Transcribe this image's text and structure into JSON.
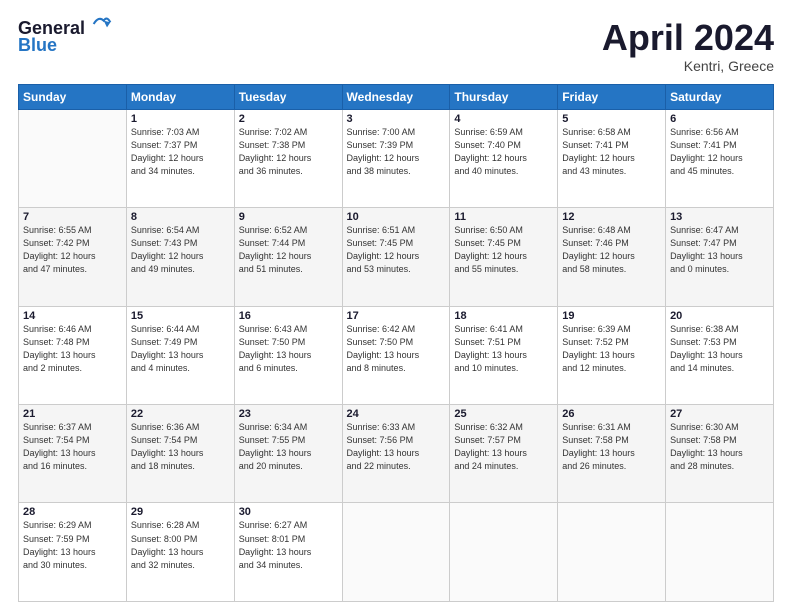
{
  "header": {
    "logo_line1": "General",
    "logo_line2": "Blue",
    "month_title": "April 2024",
    "location": "Kentri, Greece"
  },
  "weekdays": [
    "Sunday",
    "Monday",
    "Tuesday",
    "Wednesday",
    "Thursday",
    "Friday",
    "Saturday"
  ],
  "weeks": [
    [
      {
        "day": "",
        "sunrise": "",
        "sunset": "",
        "daylight": ""
      },
      {
        "day": "1",
        "sunrise": "Sunrise: 7:03 AM",
        "sunset": "Sunset: 7:37 PM",
        "daylight": "Daylight: 12 hours and 34 minutes."
      },
      {
        "day": "2",
        "sunrise": "Sunrise: 7:02 AM",
        "sunset": "Sunset: 7:38 PM",
        "daylight": "Daylight: 12 hours and 36 minutes."
      },
      {
        "day": "3",
        "sunrise": "Sunrise: 7:00 AM",
        "sunset": "Sunset: 7:39 PM",
        "daylight": "Daylight: 12 hours and 38 minutes."
      },
      {
        "day": "4",
        "sunrise": "Sunrise: 6:59 AM",
        "sunset": "Sunset: 7:40 PM",
        "daylight": "Daylight: 12 hours and 40 minutes."
      },
      {
        "day": "5",
        "sunrise": "Sunrise: 6:58 AM",
        "sunset": "Sunset: 7:41 PM",
        "daylight": "Daylight: 12 hours and 43 minutes."
      },
      {
        "day": "6",
        "sunrise": "Sunrise: 6:56 AM",
        "sunset": "Sunset: 7:41 PM",
        "daylight": "Daylight: 12 hours and 45 minutes."
      }
    ],
    [
      {
        "day": "7",
        "sunrise": "Sunrise: 6:55 AM",
        "sunset": "Sunset: 7:42 PM",
        "daylight": "Daylight: 12 hours and 47 minutes."
      },
      {
        "day": "8",
        "sunrise": "Sunrise: 6:54 AM",
        "sunset": "Sunset: 7:43 PM",
        "daylight": "Daylight: 12 hours and 49 minutes."
      },
      {
        "day": "9",
        "sunrise": "Sunrise: 6:52 AM",
        "sunset": "Sunset: 7:44 PM",
        "daylight": "Daylight: 12 hours and 51 minutes."
      },
      {
        "day": "10",
        "sunrise": "Sunrise: 6:51 AM",
        "sunset": "Sunset: 7:45 PM",
        "daylight": "Daylight: 12 hours and 53 minutes."
      },
      {
        "day": "11",
        "sunrise": "Sunrise: 6:50 AM",
        "sunset": "Sunset: 7:45 PM",
        "daylight": "Daylight: 12 hours and 55 minutes."
      },
      {
        "day": "12",
        "sunrise": "Sunrise: 6:48 AM",
        "sunset": "Sunset: 7:46 PM",
        "daylight": "Daylight: 12 hours and 58 minutes."
      },
      {
        "day": "13",
        "sunrise": "Sunrise: 6:47 AM",
        "sunset": "Sunset: 7:47 PM",
        "daylight": "Daylight: 13 hours and 0 minutes."
      }
    ],
    [
      {
        "day": "14",
        "sunrise": "Sunrise: 6:46 AM",
        "sunset": "Sunset: 7:48 PM",
        "daylight": "Daylight: 13 hours and 2 minutes."
      },
      {
        "day": "15",
        "sunrise": "Sunrise: 6:44 AM",
        "sunset": "Sunset: 7:49 PM",
        "daylight": "Daylight: 13 hours and 4 minutes."
      },
      {
        "day": "16",
        "sunrise": "Sunrise: 6:43 AM",
        "sunset": "Sunset: 7:50 PM",
        "daylight": "Daylight: 13 hours and 6 minutes."
      },
      {
        "day": "17",
        "sunrise": "Sunrise: 6:42 AM",
        "sunset": "Sunset: 7:50 PM",
        "daylight": "Daylight: 13 hours and 8 minutes."
      },
      {
        "day": "18",
        "sunrise": "Sunrise: 6:41 AM",
        "sunset": "Sunset: 7:51 PM",
        "daylight": "Daylight: 13 hours and 10 minutes."
      },
      {
        "day": "19",
        "sunrise": "Sunrise: 6:39 AM",
        "sunset": "Sunset: 7:52 PM",
        "daylight": "Daylight: 13 hours and 12 minutes."
      },
      {
        "day": "20",
        "sunrise": "Sunrise: 6:38 AM",
        "sunset": "Sunset: 7:53 PM",
        "daylight": "Daylight: 13 hours and 14 minutes."
      }
    ],
    [
      {
        "day": "21",
        "sunrise": "Sunrise: 6:37 AM",
        "sunset": "Sunset: 7:54 PM",
        "daylight": "Daylight: 13 hours and 16 minutes."
      },
      {
        "day": "22",
        "sunrise": "Sunrise: 6:36 AM",
        "sunset": "Sunset: 7:54 PM",
        "daylight": "Daylight: 13 hours and 18 minutes."
      },
      {
        "day": "23",
        "sunrise": "Sunrise: 6:34 AM",
        "sunset": "Sunset: 7:55 PM",
        "daylight": "Daylight: 13 hours and 20 minutes."
      },
      {
        "day": "24",
        "sunrise": "Sunrise: 6:33 AM",
        "sunset": "Sunset: 7:56 PM",
        "daylight": "Daylight: 13 hours and 22 minutes."
      },
      {
        "day": "25",
        "sunrise": "Sunrise: 6:32 AM",
        "sunset": "Sunset: 7:57 PM",
        "daylight": "Daylight: 13 hours and 24 minutes."
      },
      {
        "day": "26",
        "sunrise": "Sunrise: 6:31 AM",
        "sunset": "Sunset: 7:58 PM",
        "daylight": "Daylight: 13 hours and 26 minutes."
      },
      {
        "day": "27",
        "sunrise": "Sunrise: 6:30 AM",
        "sunset": "Sunset: 7:58 PM",
        "daylight": "Daylight: 13 hours and 28 minutes."
      }
    ],
    [
      {
        "day": "28",
        "sunrise": "Sunrise: 6:29 AM",
        "sunset": "Sunset: 7:59 PM",
        "daylight": "Daylight: 13 hours and 30 minutes."
      },
      {
        "day": "29",
        "sunrise": "Sunrise: 6:28 AM",
        "sunset": "Sunset: 8:00 PM",
        "daylight": "Daylight: 13 hours and 32 minutes."
      },
      {
        "day": "30",
        "sunrise": "Sunrise: 6:27 AM",
        "sunset": "Sunset: 8:01 PM",
        "daylight": "Daylight: 13 hours and 34 minutes."
      },
      {
        "day": "",
        "sunrise": "",
        "sunset": "",
        "daylight": ""
      },
      {
        "day": "",
        "sunrise": "",
        "sunset": "",
        "daylight": ""
      },
      {
        "day": "",
        "sunrise": "",
        "sunset": "",
        "daylight": ""
      },
      {
        "day": "",
        "sunrise": "",
        "sunset": "",
        "daylight": ""
      }
    ]
  ]
}
